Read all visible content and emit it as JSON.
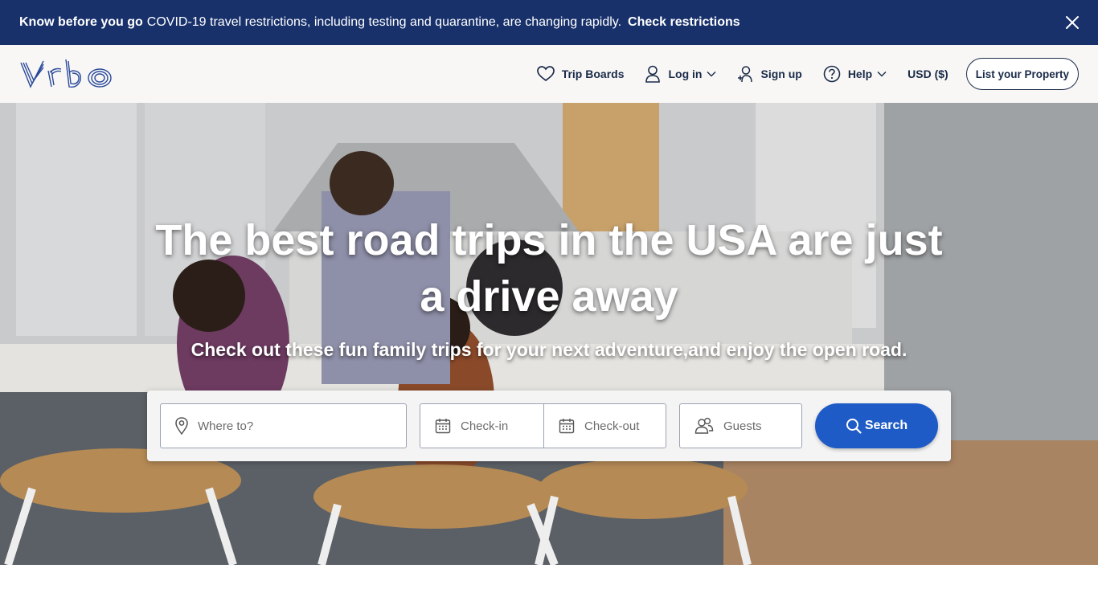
{
  "banner": {
    "bold": "Know before you go",
    "message": "COVID-19 travel restrictions, including testing and quarantine, are changing rapidly.",
    "link": "Check restrictions"
  },
  "header": {
    "logo_text": "Vrbo",
    "nav": {
      "trip_boards": "Trip Boards",
      "login": "Log in",
      "signup": "Sign up",
      "help": "Help",
      "currency": "USD ($)",
      "list_property": "List your Property"
    }
  },
  "hero": {
    "title": "The best road trips in the USA are just a drive away",
    "subtitle": "Check out these fun family trips for your next adventure,and enjoy the open road."
  },
  "search": {
    "where_placeholder": "Where to?",
    "checkin_placeholder": "Check-in",
    "checkout_placeholder": "Check-out",
    "guests_placeholder": "Guests",
    "button_label": "Search"
  },
  "colors": {
    "banner_bg": "#18316b",
    "brand_navy": "#1a2b49",
    "search_button": "#1e5bc6"
  }
}
